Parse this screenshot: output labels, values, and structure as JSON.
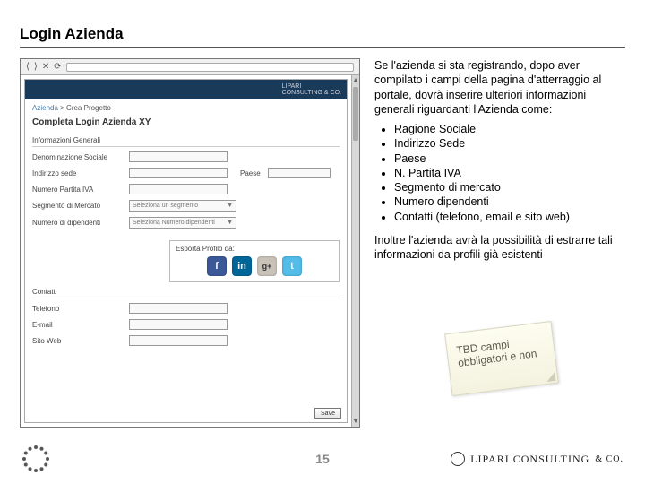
{
  "title": "Login Azienda",
  "wireframe": {
    "toolbar_icons": [
      "⟨",
      "⟩",
      "✕",
      "⟳"
    ],
    "header_brand": "LIPARI\nCONSULTING & CO.",
    "breadcrumb_link": "Azienda",
    "breadcrumb_rest": " > Crea Progetto",
    "heading": "Completa Login Azienda XY",
    "section_general": "Informazioni Generali",
    "labels": {
      "denom": "Denominazione Sociale",
      "indirizzo": "Indirizzo sede",
      "paese": "Paese",
      "piva": "Numero Partita IVA",
      "segmento": "Segmento di Mercato",
      "dipendenti": "Numero di dipendenti"
    },
    "select_segmento_placeholder": "Seleziona un segmento",
    "select_dipendenti_placeholder": "Seleziona Numero dipendenti",
    "import_caption": "Esporta Profilo da:",
    "section_contacts": "Contatti",
    "contacts": {
      "telefono": "Telefono",
      "email": "E-mail",
      "web": "Sito Web"
    },
    "save_label": "Save"
  },
  "description": {
    "intro": "Se l'azienda si sta registrando, dopo aver compilato i campi della pagina d'atterraggio al portale, dovrà inserire ulteriori informazioni generali riguardanti l'Azienda come:",
    "bullets": [
      "Ragione Sociale",
      "Indirizzo Sede",
      "Paese",
      "N. Partita IVA",
      "Segmento di mercato",
      "Numero dipendenti",
      "Contatti (telefono, email e sito web)"
    ],
    "outro": "Inoltre l'azienda avrà la possibilità di estrarre tali informazioni da profili già esistenti"
  },
  "sticky": {
    "line1": "TBD campi",
    "line2": "obbligatori e non"
  },
  "footer": {
    "page": "15",
    "company": "LIPARI CONSULTING",
    "company_suffix": "& CO."
  }
}
